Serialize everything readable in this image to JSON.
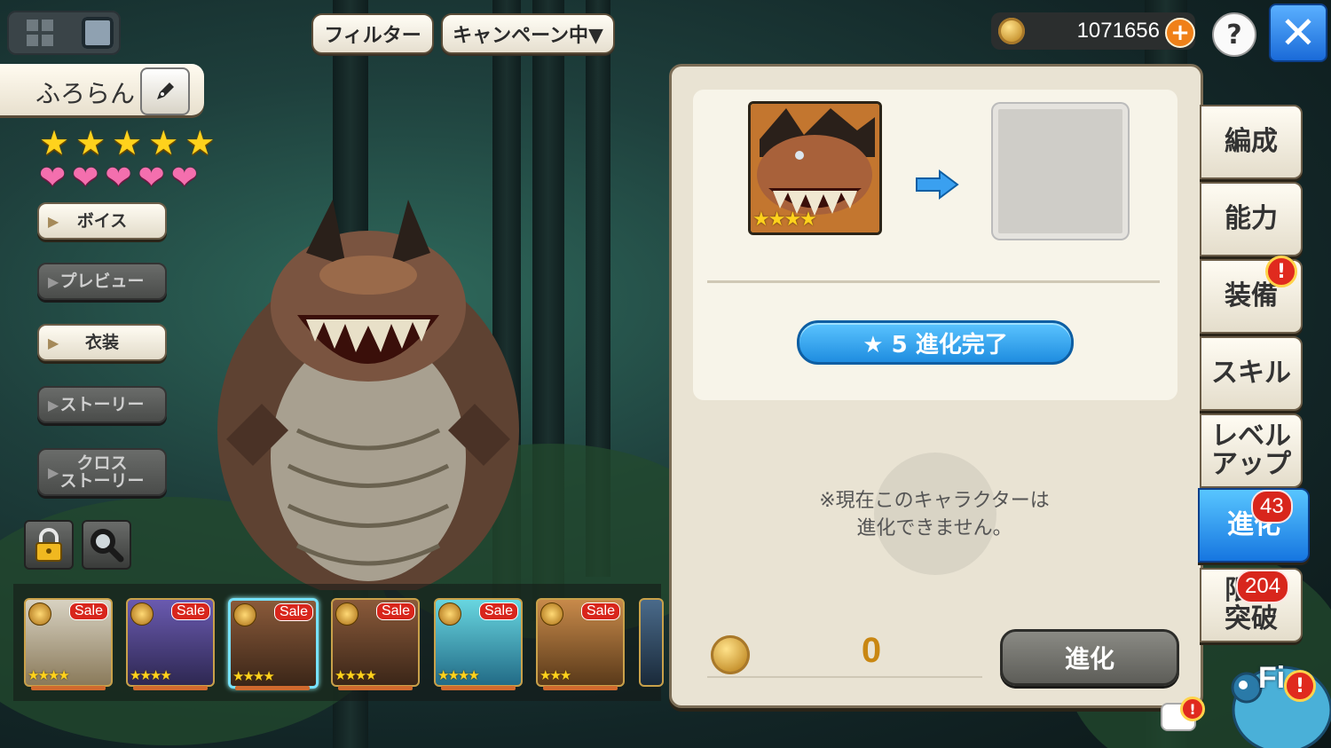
{
  "header": {
    "filter_label": "フィルター",
    "campaign_label": "キャンペーン中▼",
    "currency_amount": "1071656",
    "plus_label": "+",
    "help_label": "?",
    "close_label": "✕"
  },
  "character": {
    "name": "ふろらん",
    "rarity_stars": 5,
    "affection_hearts": 5,
    "star_glyph": "★",
    "heart_glyph": "❤"
  },
  "side_buttons": [
    {
      "label": "ボイス",
      "enabled": true
    },
    {
      "label": "プレビュー",
      "enabled": false
    },
    {
      "label": "衣装",
      "enabled": true
    },
    {
      "label": "ストーリー",
      "enabled": false
    },
    {
      "label": "クロス\nストーリー",
      "enabled": false
    }
  ],
  "icon_buttons": [
    {
      "name": "lock-icon"
    },
    {
      "name": "magnifier-icon"
    }
  ],
  "roster": [
    {
      "stars": "★★★★",
      "sale": "Sale",
      "icon": "fire-element-icon",
      "colors": [
        "#d8d2c2",
        "#8a7a5a"
      ]
    },
    {
      "stars": "★★★★",
      "sale": "Sale",
      "icon": "fire-element-icon",
      "colors": [
        "#6a5ab0",
        "#2e2852"
      ]
    },
    {
      "stars": "★★★★",
      "sale": "Sale",
      "icon": "fire-element-icon",
      "colors": [
        "#8a5a3a",
        "#3b2618"
      ]
    },
    {
      "stars": "★★★★",
      "sale": "Sale",
      "icon": "fire-element-icon",
      "colors": [
        "#8a5a3a",
        "#3b2618"
      ]
    },
    {
      "stars": "★★★★",
      "sale": "Sale",
      "icon": "water-element-icon",
      "colors": [
        "#68d6e0",
        "#226b86"
      ]
    },
    {
      "stars": "★★★",
      "sale": "Sale",
      "icon": "wind-element-icon",
      "colors": [
        "#c88a4a",
        "#5a3a1a"
      ]
    }
  ],
  "evolution": {
    "status_label": "★ 5 進化完了",
    "note": "※現在このキャラクターは\n進化できません。",
    "cost": "0",
    "evolve_button": "進化",
    "portrait_stars": "★★★★"
  },
  "tabs": [
    {
      "label": "編成"
    },
    {
      "label": "能力"
    },
    {
      "label": "装備",
      "alert": "!"
    },
    {
      "label": "スキル"
    },
    {
      "label": "レベル\nアップ"
    },
    {
      "label": "進化",
      "badge": "43",
      "active": true
    },
    {
      "label": "限界\n突破",
      "badge": "204"
    }
  ],
  "mascot": {
    "label": "Fi",
    "alert": "!",
    "chat_alert": "!"
  },
  "colors": {
    "accent_blue": "#1f8de0",
    "gold": "#c98712",
    "badge_red": "#d8261c"
  }
}
